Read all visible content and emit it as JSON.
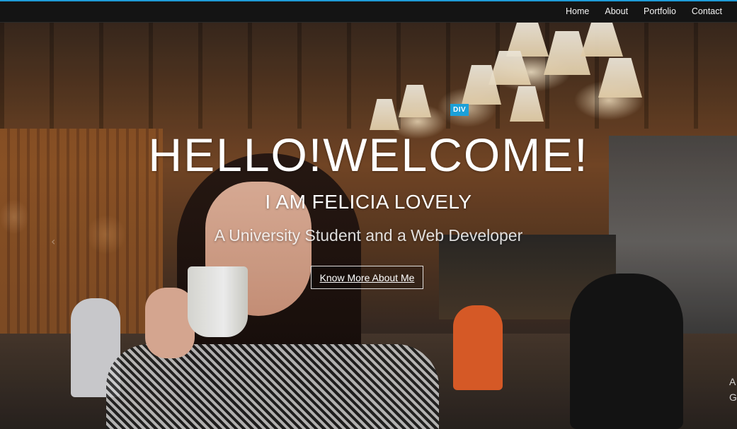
{
  "nav": {
    "items": [
      {
        "label": "Home"
      },
      {
        "label": "About"
      },
      {
        "label": "Portfolio"
      },
      {
        "label": "Contact"
      }
    ]
  },
  "hero": {
    "badge": "DIV",
    "title": "HELLO!WELCOME!",
    "subtitle": "I AM FELICIA LOVELY",
    "tagline": "A University Student and a Web Developer",
    "cta_label": "Know More About Me",
    "side_text_1": "A",
    "side_text_2": "G"
  },
  "colors": {
    "accent": "#1ba0d8",
    "navbar": "#141414"
  }
}
